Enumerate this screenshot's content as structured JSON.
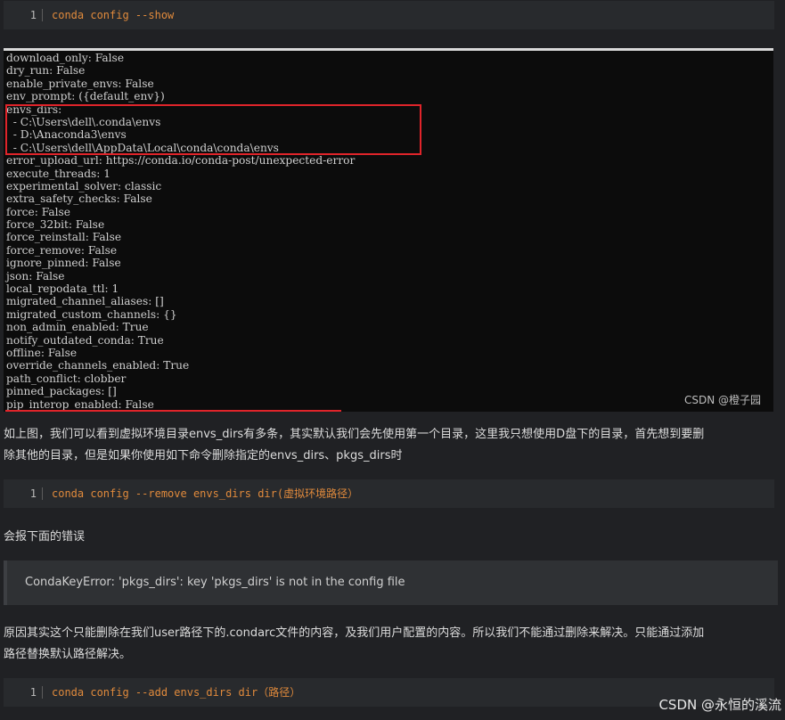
{
  "code_blocks": [
    {
      "line_number": "1",
      "code": "conda config --show"
    },
    {
      "line_number": "1",
      "code": "conda config --remove envs_dirs dir(虚拟环境路径）"
    },
    {
      "line_number": "1",
      "code": "conda config --add envs_dirs dir（路径）"
    }
  ],
  "terminal_lines": [
    "download_only: False",
    "dry_run: False",
    "enable_private_envs: False",
    "env_prompt: ({default_env})",
    "envs_dirs:",
    "  - C:\\Users\\dell\\.conda\\envs",
    "  - D:\\Anaconda3\\envs",
    "  - C:\\Users\\dell\\AppData\\Local\\conda\\conda\\envs",
    "error_upload_url: https://conda.io/conda-post/unexpected-error",
    "execute_threads: 1",
    "experimental_solver: classic",
    "extra_safety_checks: False",
    "force: False",
    "force_32bit: False",
    "force_reinstall: False",
    "force_remove: False",
    "ignore_pinned: False",
    "json: False",
    "local_repodata_ttl: 1",
    "migrated_channel_aliases: []",
    "migrated_custom_channels: {}",
    "non_admin_enabled: True",
    "notify_outdated_conda: True",
    "offline: False",
    "override_channels_enabled: True",
    "path_conflict: clobber",
    "pinned_packages: []",
    "pip_interop_enabled: False"
  ],
  "image_watermark": "CSDN @橙子园",
  "paragraphs": {
    "p1_line1": "如上图，我们可以看到虚拟环境目录envs_dirs有多条，其实默认我们会先使用第一个目录，这里我只想使用D盘下的目录，首先想到要删",
    "p1_line2": "除其他的目录，但是如果你使用如下命令删除指定的envs_dirs、pkgs_dirs时",
    "p2": "会报下面的错误",
    "p3_line1": "原因其实这个只能删除在我们user路径下的.condarc文件的内容，及我们用户配置的内容。所以我们不能通过删除来解决。只能通过添加",
    "p3_line2": "路径替换默认路径解决。"
  },
  "quote": "CondaKeyError: 'pkgs_dirs': key 'pkgs_dirs' is not in the config file",
  "page_watermark": "CSDN @永恒的溪流"
}
